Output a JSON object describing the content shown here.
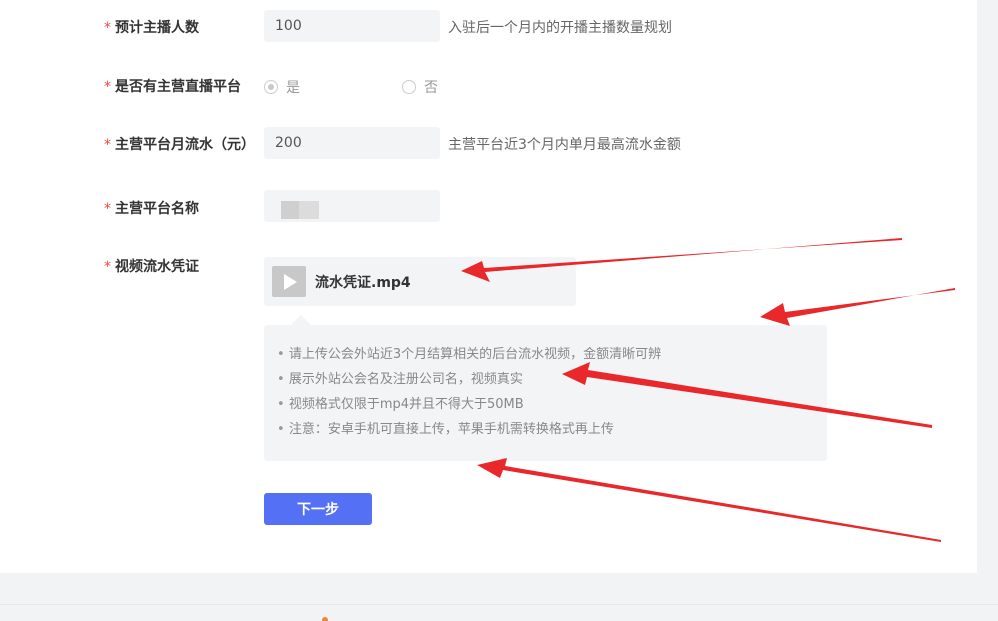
{
  "form": {
    "required_mark": "*",
    "fields": {
      "anchors": {
        "label": "预计主播人数",
        "value": "100",
        "hint": "入驻后一个月内的开播主播数量规划"
      },
      "main_platform": {
        "label": "是否有主营直播平台",
        "options": [
          "是",
          "否"
        ],
        "selected": "是"
      },
      "monthly_flow": {
        "label": "主营平台月流水（元）",
        "value": "200",
        "hint": "主营平台近3个月内单月最高流水金额"
      },
      "platform_name": {
        "label": "主营平台名称",
        "value": ""
      },
      "video_proof": {
        "label": "视频流水凭证",
        "file_name": "流水凭证.mp4",
        "file_icon": "video-play-icon",
        "tips": [
          "请上传公会外站近3个月结算相关的后台流水视频，金额清晰可辨",
          "展示外站公会名及注册公司名，视频真实",
          "视频格式仅限于mp4并且不得大于50MB",
          "注意：安卓手机可直接上传，苹果手机需转换格式再上传"
        ]
      }
    },
    "next_button": "下一步"
  },
  "colors": {
    "required": "#f0483e",
    "primary_button": "#5470f5",
    "annotation_arrow": "#e8282a"
  }
}
